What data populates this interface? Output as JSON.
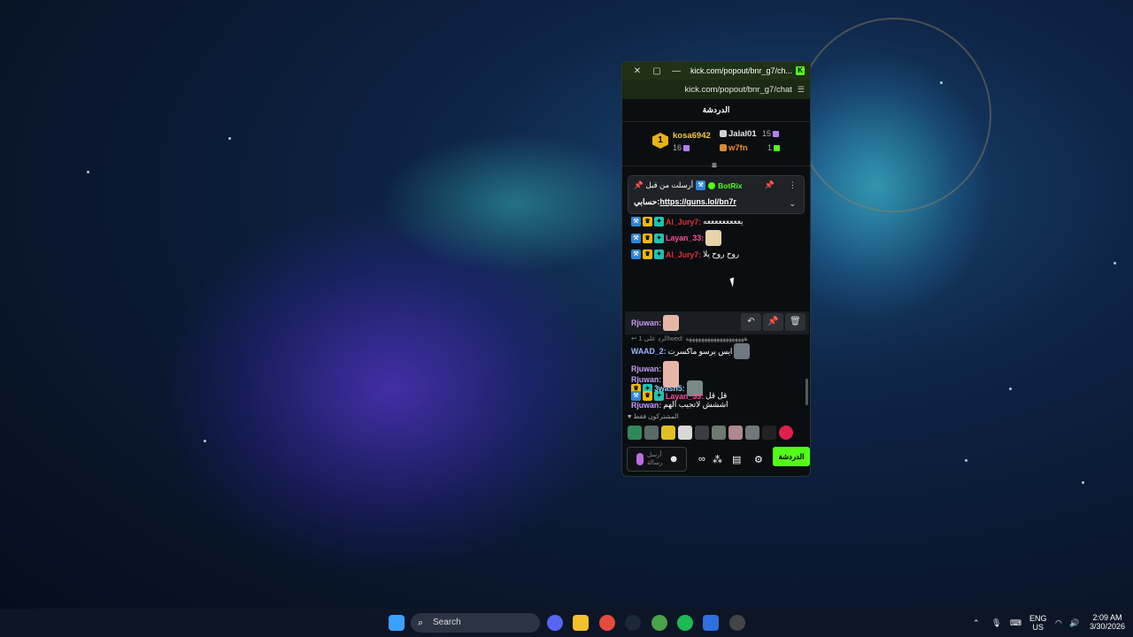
{
  "browser": {
    "title": "kick.com/popout/bnr_g7/ch...",
    "url": "kick.com/popout/bnr_g7/chat"
  },
  "chat": {
    "header": "الدردشة",
    "leaderboard": {
      "first": {
        "name": "kosa6942",
        "count": "16"
      },
      "second": {
        "name": "Jalal01",
        "count": "15"
      },
      "third": {
        "name": "w7fn",
        "count": "1"
      }
    },
    "pinned": {
      "label": "أرسلت من قبل",
      "user": "BotRix",
      "prefix": "حسابي:",
      "link": "https://guns.lol/bn7r"
    },
    "messages": [
      {
        "user": "Al_Jury7:",
        "text": "يعععععععععه",
        "user_color": "#e0303a"
      },
      {
        "user": "Layan_33:",
        "text": "",
        "user_color": "#ff4d9a"
      },
      {
        "user": "Al_Jury7:",
        "text": "روح روح يلا",
        "user_color": "#e0303a"
      },
      {
        "user": "Rjuwan:",
        "text": "",
        "user_color": "#c69cf5"
      },
      {
        "user": "WAAD_2:",
        "text": "ايس يرسو ماكسرت",
        "user_color": "#9ab6ff"
      },
      {
        "user": "Rjuwan:",
        "text": "",
        "user_color": "#c69cf5"
      },
      {
        "user": "3wash5:",
        "text": "",
        "user_color": "#8dd3ff"
      },
      {
        "user": "Rjuwan:",
        "text": "اششش لاتجيب الهم",
        "user_color": "#c69cf5"
      },
      {
        "user": "Rjuwan:",
        "text": "",
        "user_color": "#c69cf5"
      },
      {
        "user": "Layan_33:",
        "text": "قل قل",
        "user_color": "#ff4d9a"
      }
    ],
    "reply_text": "الرد على 1lwed: هههههههههههههههههههه",
    "subscribers_only": "المشتركون فقط",
    "send_placeholder": "أرسل رسالة",
    "chat_button": "الدردشة"
  },
  "taskbar": {
    "search_label": "Search",
    "lang_top": "ENG",
    "lang_bottom": "US",
    "time": "2:09 AM",
    "date": "3/30/2026"
  },
  "colors": {
    "brand": "#53fc18",
    "gold": "#f5c842"
  }
}
